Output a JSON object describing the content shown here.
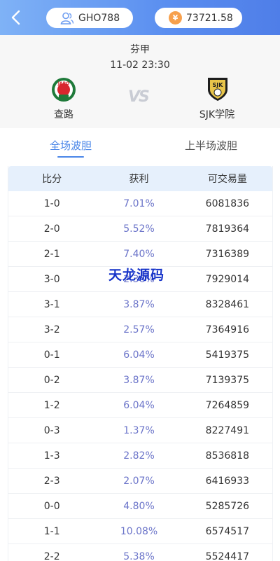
{
  "header": {
    "username": "GHO788",
    "balance": "73721.58",
    "coin_symbol": "¥"
  },
  "match": {
    "league": "芬甲",
    "time": "11-02 23:30",
    "vs_text": "VS",
    "home_team": {
      "name": "查路",
      "badge_text": "JARO"
    },
    "away_team": {
      "name": "SJK学院",
      "badge_text": "SJK"
    }
  },
  "tabs": [
    {
      "label": "全场波胆",
      "active": true
    },
    {
      "label": "上半场波胆",
      "active": false
    }
  ],
  "table": {
    "headers": [
      "比分",
      "获利",
      "可交易量"
    ],
    "rows": [
      {
        "score": "1-0",
        "profit": "7.01%",
        "volume": "6081836"
      },
      {
        "score": "2-0",
        "profit": "5.52%",
        "volume": "7819364"
      },
      {
        "score": "2-1",
        "profit": "7.40%",
        "volume": "7316389"
      },
      {
        "score": "3-0",
        "profit": "2.36%",
        "volume": "7929014"
      },
      {
        "score": "3-1",
        "profit": "3.87%",
        "volume": "8328461"
      },
      {
        "score": "3-2",
        "profit": "2.57%",
        "volume": "7364916"
      },
      {
        "score": "0-1",
        "profit": "6.04%",
        "volume": "5419375"
      },
      {
        "score": "0-2",
        "profit": "3.87%",
        "volume": "7139375"
      },
      {
        "score": "1-2",
        "profit": "6.04%",
        "volume": "7264859"
      },
      {
        "score": "0-3",
        "profit": "1.37%",
        "volume": "8227491"
      },
      {
        "score": "1-3",
        "profit": "2.82%",
        "volume": "8536818"
      },
      {
        "score": "2-3",
        "profit": "2.07%",
        "volume": "6416933"
      },
      {
        "score": "0-0",
        "profit": "4.80%",
        "volume": "5285726"
      },
      {
        "score": "1-1",
        "profit": "10.08%",
        "volume": "6574517"
      },
      {
        "score": "2-2",
        "profit": "5.38%",
        "volume": "5524417"
      }
    ]
  },
  "watermark": "天龙源码",
  "colors": {
    "header_gradient_start": "#7fb2f6",
    "header_gradient_end": "#4f7ee8",
    "accent": "#4a86e8",
    "profit_text": "#6b74c9",
    "table_header_bg": "#e6f0fc",
    "coin": "#f7a04c"
  }
}
